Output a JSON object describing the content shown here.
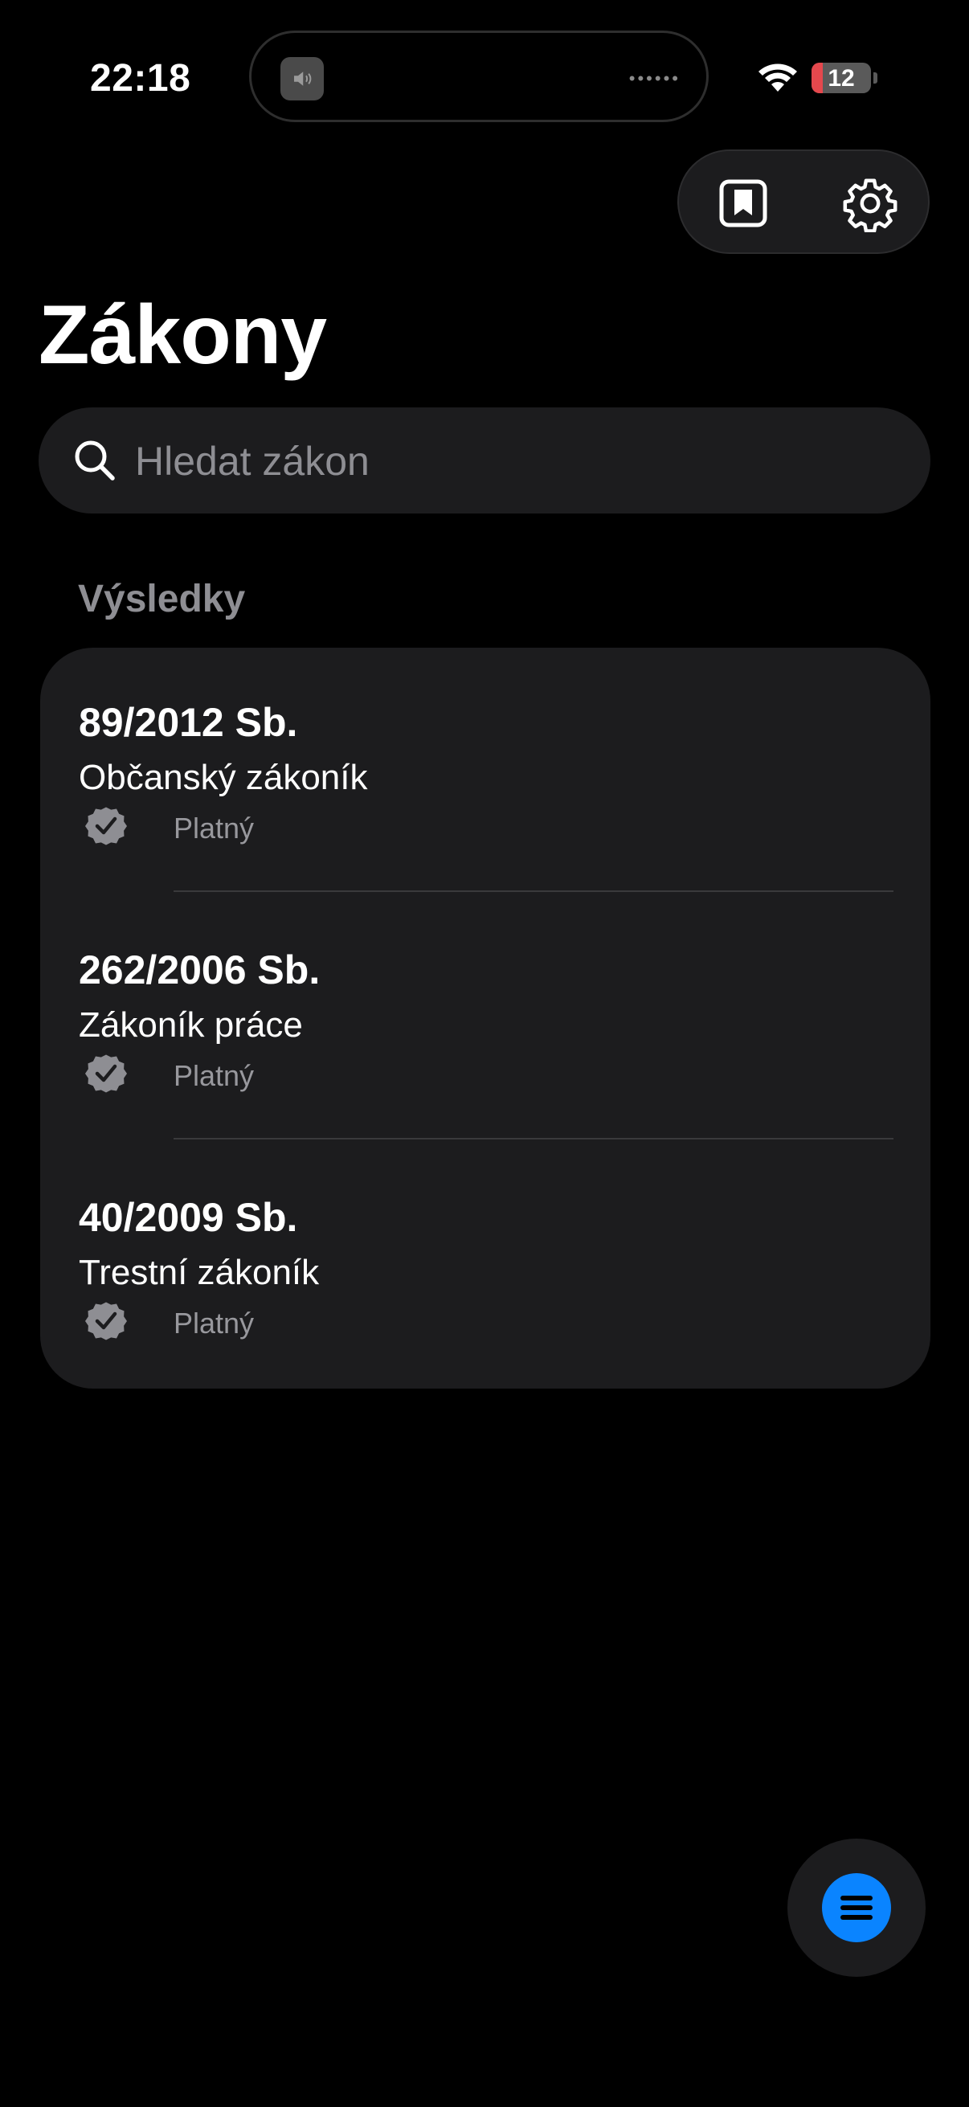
{
  "status_bar": {
    "time": "22:18",
    "battery": "12"
  },
  "page": {
    "title": "Zákony"
  },
  "search": {
    "placeholder": "Hledat zákon",
    "value": ""
  },
  "results": {
    "label": "Výsledky",
    "items": [
      {
        "code": "89/2012 Sb.",
        "name": "Občanský zákoník",
        "status": "Platný"
      },
      {
        "code": "262/2006 Sb.",
        "name": "Zákoník práce",
        "status": "Platný"
      },
      {
        "code": "40/2009 Sb.",
        "name": "Trestní zákoník",
        "status": "Platný"
      }
    ]
  },
  "icons": {
    "bookmark": "bookmark-icon",
    "settings": "gear-icon",
    "search": "search-icon",
    "status": "checkmark-seal-icon",
    "menu": "list-icon"
  },
  "colors": {
    "accent": "#0a84ff",
    "card": "#1c1c1e",
    "background": "#000000",
    "battery_low": "#e5484d"
  }
}
